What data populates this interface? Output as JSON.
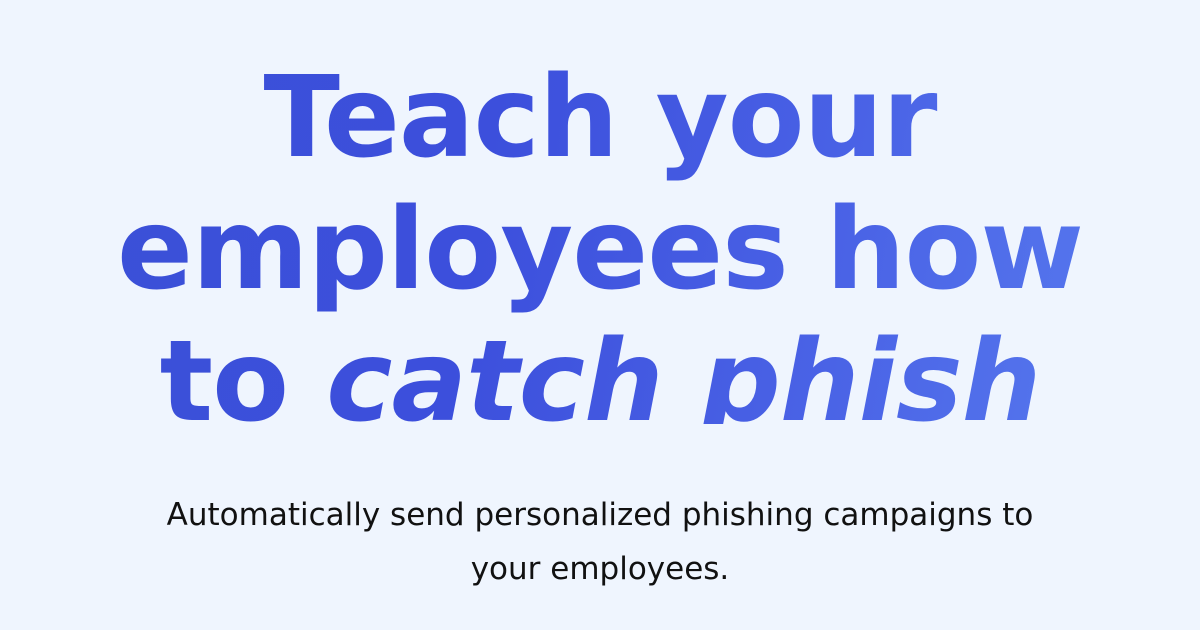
{
  "hero": {
    "headline": {
      "line1": "Teach your",
      "line2": "employees how",
      "line3_prefix": "to ",
      "line3_emphasis": "catch phish"
    },
    "subtitle": "Automatically send personalized phishing campaigns to your employees."
  },
  "colors": {
    "background": "#eff5fe",
    "headline_gradient_start": "#3a50d6",
    "headline_gradient_end": "#5a7ef0",
    "subtitle_text": "#111111"
  }
}
